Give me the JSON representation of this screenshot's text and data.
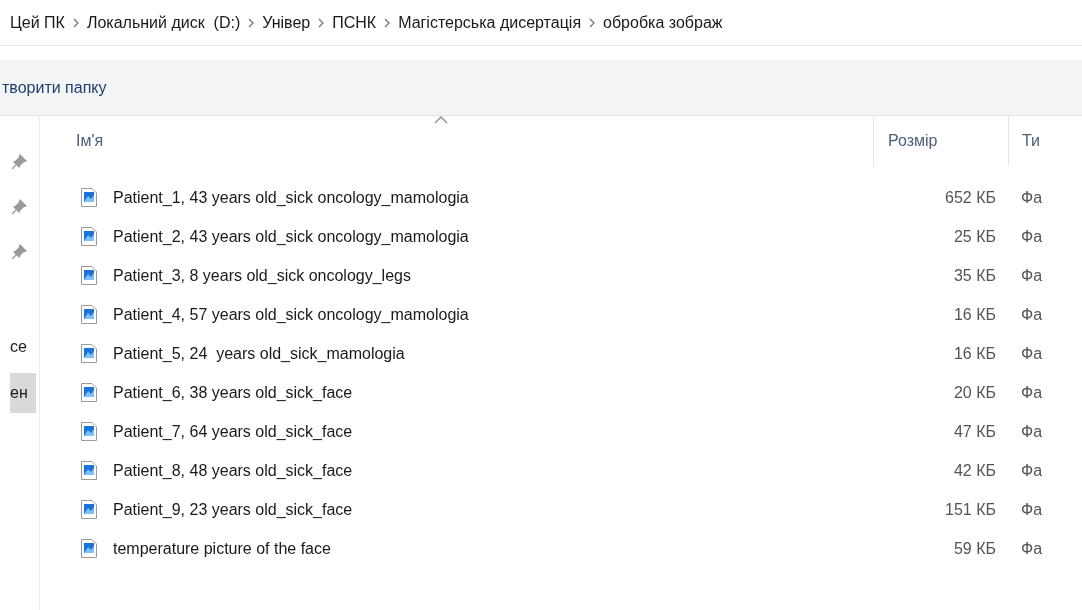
{
  "breadcrumb": [
    "Цей ПК",
    "Локальний диск  (D:)",
    "Універ",
    "ПСНК",
    "Магістерська дисертація",
    "обробка зображ"
  ],
  "toolbar": {
    "new_folder": "творити папку"
  },
  "sidebar": {
    "items": [
      {
        "label": "се",
        "selected": false
      },
      {
        "label": "ен",
        "selected": true
      }
    ]
  },
  "table": {
    "columns": [
      "Ім'я",
      "Розмір",
      "Ти"
    ],
    "rows": [
      {
        "name": "Patient_1, 43 years old_sick oncology_mamologia",
        "size": "652 КБ",
        "type": "Фа"
      },
      {
        "name": "Patient_2, 43 years old_sick oncology_mamologia",
        "size": "25 КБ",
        "type": "Фа"
      },
      {
        "name": "Patient_3, 8 years old_sick oncology_legs",
        "size": "35 КБ",
        "type": "Фа"
      },
      {
        "name": "Patient_4, 57 years old_sick oncology_mamologia",
        "size": "16 КБ",
        "type": "Фа"
      },
      {
        "name": "Patient_5, 24  years old_sick_mamologia",
        "size": "16 КБ",
        "type": "Фа"
      },
      {
        "name": "Patient_6, 38 years old_sick_face",
        "size": "20 КБ",
        "type": "Фа"
      },
      {
        "name": "Patient_7, 64 years old_sick_face",
        "size": "47 КБ",
        "type": "Фа"
      },
      {
        "name": "Patient_8, 48 years old_sick_face",
        "size": "42 КБ",
        "type": "Фа"
      },
      {
        "name": "Patient_9, 23 years old_sick_face",
        "size": "151 КБ",
        "type": "Фа"
      },
      {
        "name": "temperature picture of the face",
        "size": "59 КБ",
        "type": "Фа"
      }
    ]
  }
}
